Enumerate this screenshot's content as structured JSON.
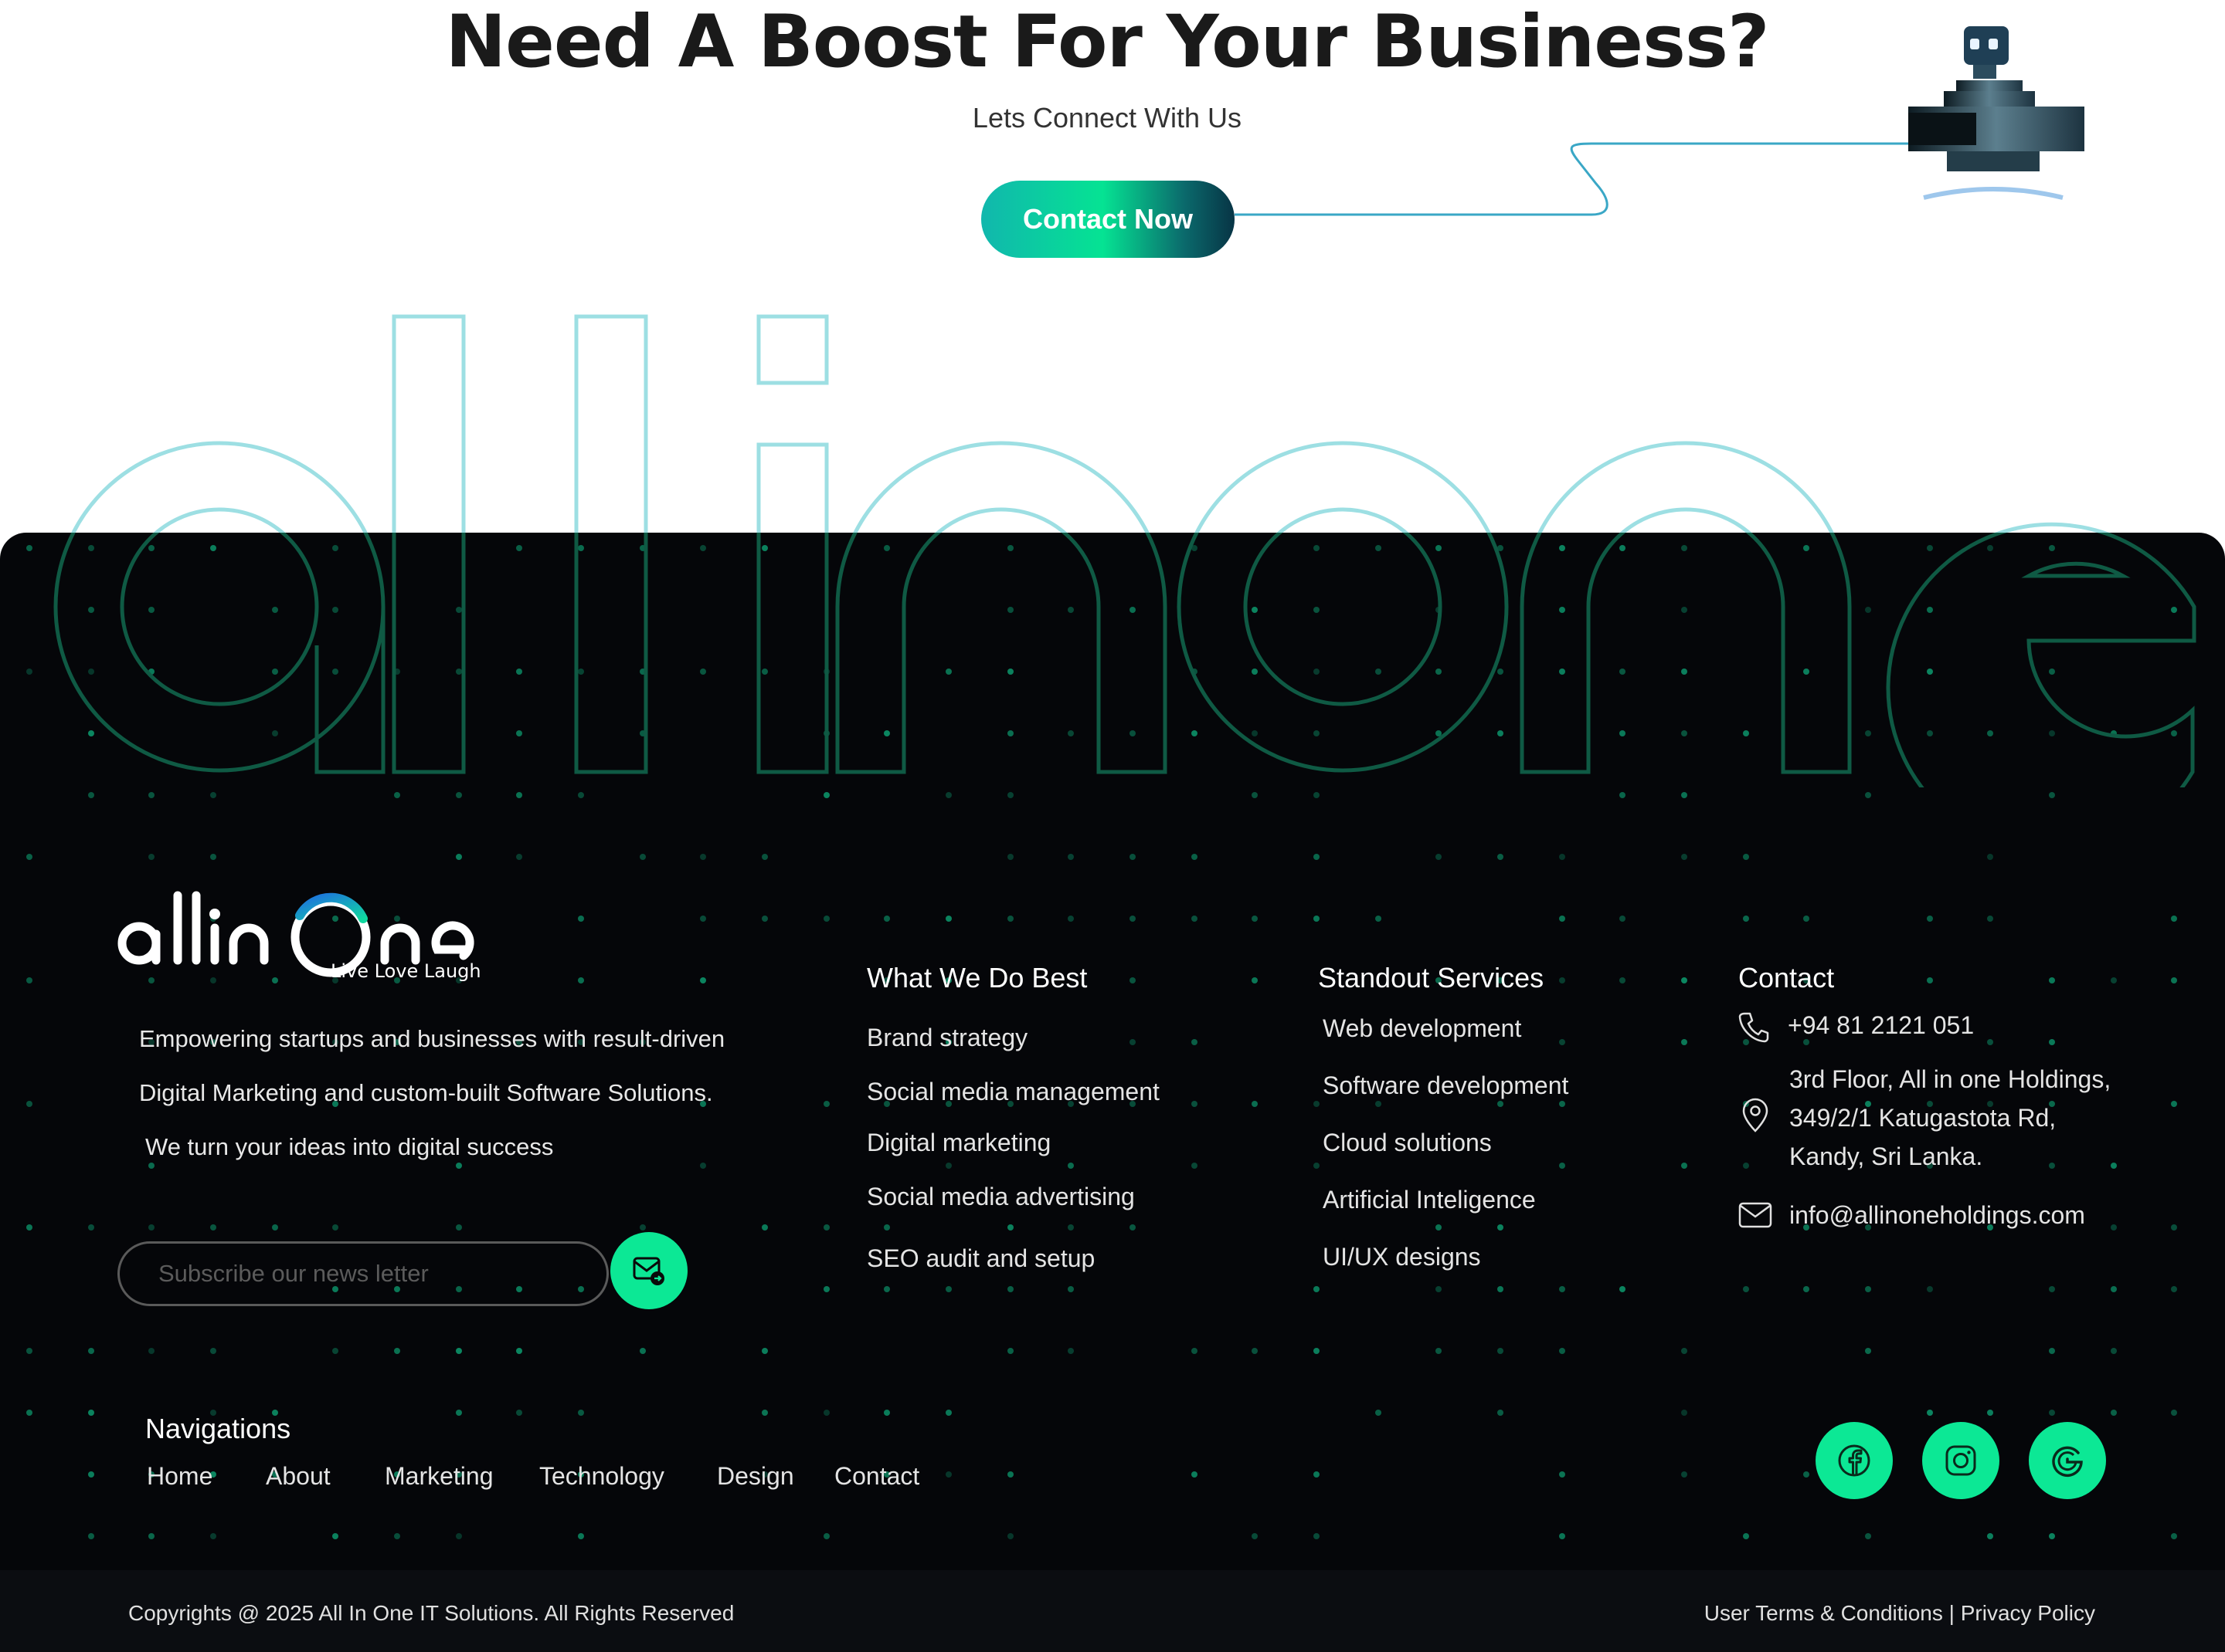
{
  "cta": {
    "title": "Need A Boost For Your Business?",
    "subtitle": "Lets Connect With Us",
    "button_label": "Contact Now"
  },
  "brand": {
    "logo_text": "allinOne",
    "tagline": "Live Love Laugh",
    "watermark_word": "allinone"
  },
  "about": {
    "line1": "Empowering startups and businesses with result-driven",
    "line2": "Digital Marketing and custom-built Software Solutions.",
    "line3": "We turn your ideas into digital success"
  },
  "subscribe": {
    "placeholder": "Subscribe our news letter",
    "icon": "mail-send-icon"
  },
  "what_we_do": {
    "title": "What We Do Best",
    "items": [
      "Brand strategy",
      "Social media management",
      "Digital marketing",
      "Social media advertising",
      "SEO audit and setup"
    ]
  },
  "services": {
    "title": "Standout Services",
    "items": [
      "Web development",
      "Software development",
      "Cloud solutions",
      "Artificial Inteligence",
      "UI/UX designs"
    ]
  },
  "contact": {
    "title": "Contact",
    "phone": "+94 81 2121 051",
    "address_line1": "3rd Floor, All in one Holdings,",
    "address_line2": "349/2/1 Katugastota Rd,",
    "address_line3": "Kandy, Sri Lanka.",
    "email": "info@allinoneholdings.com",
    "icons": [
      "phone-icon",
      "location-pin-icon",
      "mail-icon"
    ]
  },
  "navigation": {
    "title": "Navigations",
    "items": [
      "Home",
      "About",
      "Marketing",
      "Technology",
      "Design",
      "Contact"
    ]
  },
  "social": [
    "facebook-icon",
    "instagram-icon",
    "google-icon"
  ],
  "bottom": {
    "copyright": "Copyrights @ 2025 All In One IT Solutions. All Rights Reserved",
    "terms": "User Terms & Conditions",
    "separator": "|",
    "privacy": "Privacy Policy"
  },
  "colors": {
    "accent_green": "#0ce895",
    "footer_bg": "#050609",
    "outline_light": "#9ddfe3",
    "outline_dark": "#0f5a44",
    "dot": "#0c8e66"
  }
}
